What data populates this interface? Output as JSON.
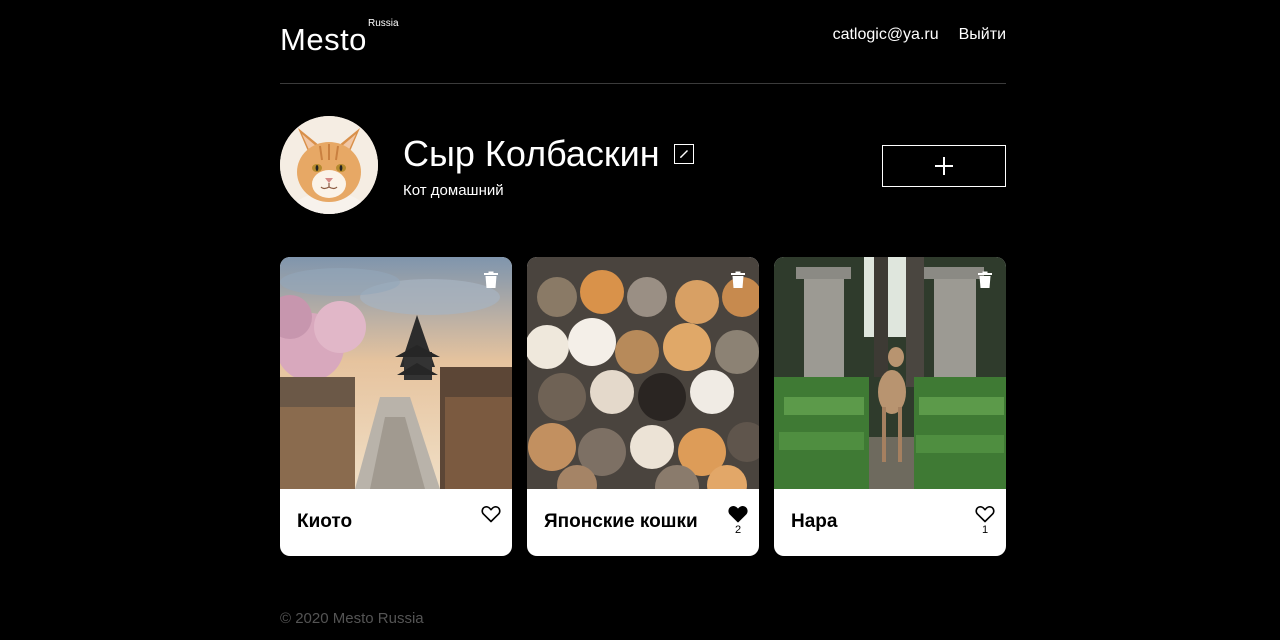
{
  "header": {
    "logo": "Mesto",
    "logo_sub": "Russia",
    "email": "catlogic@ya.ru",
    "logout": "Выйти"
  },
  "profile": {
    "name": "Сыр Колбаскин",
    "about": "Кот домашний",
    "edit_icon": "pencil-icon",
    "add_icon": "plus-icon"
  },
  "cards": [
    {
      "title": "Киото",
      "likes": "",
      "liked": false
    },
    {
      "title": "Японские кошки",
      "likes": "2",
      "liked": true
    },
    {
      "title": "Нара",
      "likes": "1",
      "liked": false
    }
  ],
  "footer": {
    "copyright": "© 2020 Mesto Russia"
  },
  "colors": {
    "background": "#000000",
    "card": "#ffffff",
    "footer_text": "#545454",
    "divider": "#545454"
  }
}
